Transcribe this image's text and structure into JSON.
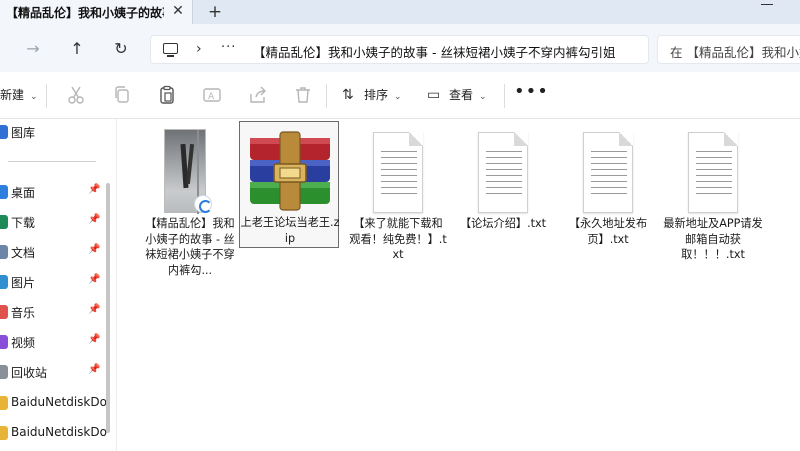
{
  "tabs": [
    {
      "title": "【精品乱伦】我和小姨子的故事",
      "active": true
    }
  ],
  "tab_close_glyph": "✕",
  "new_tab_glyph": "+",
  "address": {
    "chevron": "›",
    "ellipsis": "···",
    "path": "【精品乱伦】我和小姨子的故事 - 丝袜短裙小姨子不穿内裤勾引姐",
    "search_placeholder": "在 【精品乱伦】我和小姨"
  },
  "nav": {
    "back": "→",
    "up": "↑",
    "refresh": "↻"
  },
  "toolbar": {
    "new_label": "新建",
    "sort_label": "排序",
    "view_label": "查看",
    "more_label": "•••",
    "caret": "⌄"
  },
  "sidebar": {
    "items": [
      {
        "label": "图库",
        "color": "#2f6fd6",
        "pinned": false
      },
      {
        "label": "桌面",
        "color": "#2f7fe0",
        "pinned": true
      },
      {
        "label": "下载",
        "color": "#1d8a58",
        "pinned": true
      },
      {
        "label": "文档",
        "color": "#6c86a8",
        "pinned": true
      },
      {
        "label": "图片",
        "color": "#2f8fd0",
        "pinned": true
      },
      {
        "label": "音乐",
        "color": "#e0524b",
        "pinned": true
      },
      {
        "label": "视频",
        "color": "#8a4fd8",
        "pinned": true
      },
      {
        "label": "回收站",
        "color": "#8a9099",
        "pinned": true
      },
      {
        "label": "BaiduNetdiskDo",
        "color": "#e8b437",
        "pinned": false
      },
      {
        "label": "BaiduNetdiskDo",
        "color": "#e8b437",
        "pinned": false
      }
    ],
    "pin_glyph": "📌"
  },
  "files": [
    {
      "name": "【精品乱伦】我和小姨子的故事 - 丝袜短裙小姨子不穿内裤勾...",
      "type": "video"
    },
    {
      "name": "上老王论坛当老王.zip",
      "type": "zip",
      "selected": true
    },
    {
      "name": "【来了就能下载和观看！纯免费！】.txt",
      "type": "txt"
    },
    {
      "name": "【论坛介绍】.txt",
      "type": "txt"
    },
    {
      "name": "【永久地址发布页】.txt",
      "type": "txt"
    },
    {
      "name": "最新地址及APP请发邮箱自动获取！！！.txt",
      "type": "txt"
    }
  ]
}
